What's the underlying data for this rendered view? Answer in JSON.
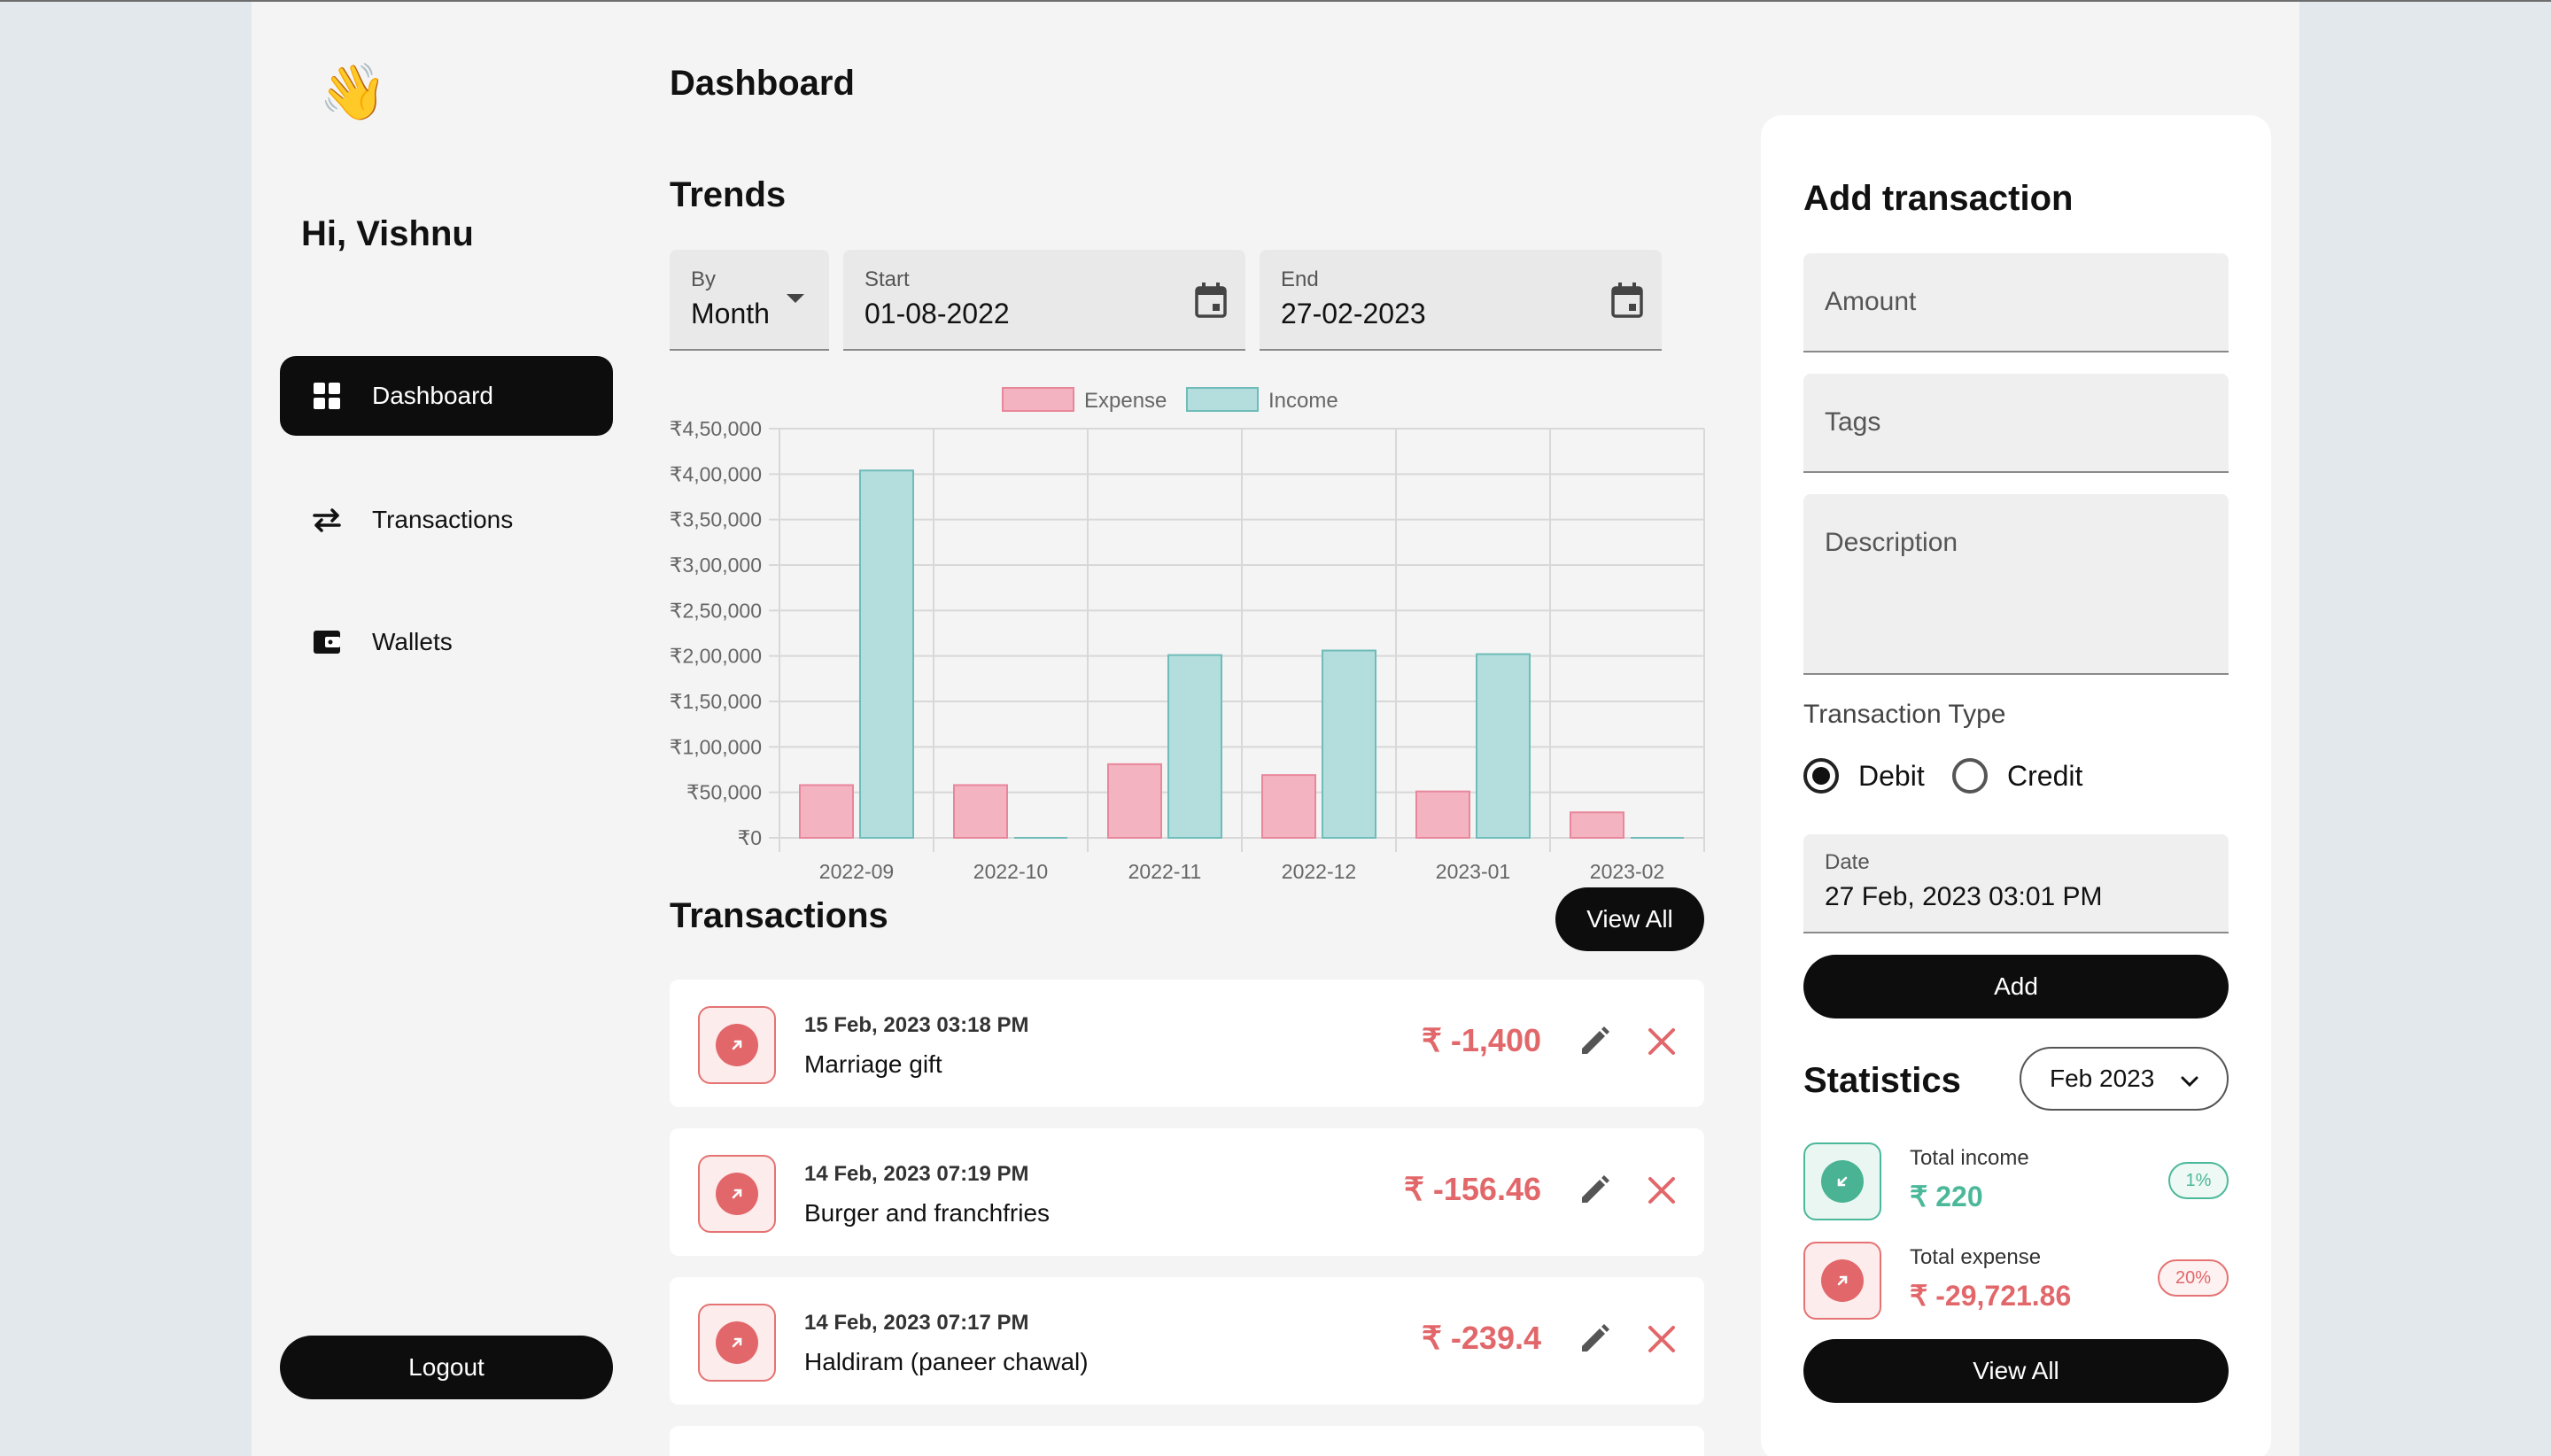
{
  "sidebar": {
    "emoji": "👋",
    "greeting": "Hi, Vishnu",
    "items": [
      {
        "label": "Dashboard",
        "icon": "grid-icon",
        "active": true
      },
      {
        "label": "Transactions",
        "icon": "swap-arrows-icon",
        "active": false
      },
      {
        "label": "Wallets",
        "icon": "wallet-icon",
        "active": false
      }
    ],
    "logout_label": "Logout"
  },
  "main": {
    "title": "Dashboard",
    "trends_title": "Trends",
    "filters": {
      "by": {
        "label": "By",
        "value": "Month"
      },
      "start": {
        "label": "Start",
        "value": "01-08-2022"
      },
      "end": {
        "label": "End",
        "value": "27-02-2023"
      }
    },
    "transactions_title": "Transactions",
    "view_all_label": "View All",
    "transactions": [
      {
        "date": "15 Feb, 2023 03:18 PM",
        "description": "Marriage gift",
        "amount": "₹ -1,400"
      },
      {
        "date": "14 Feb, 2023 07:19 PM",
        "description": "Burger and franchfries",
        "amount": "₹ -156.46"
      },
      {
        "date": "14 Feb, 2023 07:17 PM",
        "description": "Haldiram (paneer chawal)",
        "amount": "₹ -239.4"
      }
    ]
  },
  "chart_data": {
    "type": "bar",
    "categories": [
      "2022-09",
      "2022-10",
      "2022-11",
      "2022-12",
      "2023-01",
      "2023-02"
    ],
    "series": [
      {
        "name": "Expense",
        "values": [
          58000,
          58000,
          81000,
          69000,
          51000,
          28000
        ],
        "color": "#f4b3c0",
        "stroke": "#e8879b"
      },
      {
        "name": "Income",
        "values": [
          404000,
          0,
          201000,
          206000,
          202000,
          0
        ],
        "color": "#b3dedd",
        "stroke": "#6fbcb9"
      }
    ],
    "ylim": [
      0,
      450000
    ],
    "yticks": [
      "₹0",
      "₹50,000",
      "₹1,00,000",
      "₹1,50,000",
      "₹2,00,000",
      "₹2,50,000",
      "₹3,00,000",
      "₹3,50,000",
      "₹4,00,000",
      "₹4,50,000"
    ],
    "legend": "top-center",
    "grid": true
  },
  "add_transaction": {
    "title": "Add transaction",
    "amount_placeholder": "Amount",
    "tags_placeholder": "Tags",
    "description_placeholder": "Description",
    "type_label": "Transaction Type",
    "debit_label": "Debit",
    "credit_label": "Credit",
    "selected_type": "Debit",
    "date_label": "Date",
    "date_value": "27 Feb, 2023 03:01 PM",
    "add_label": "Add"
  },
  "statistics": {
    "title": "Statistics",
    "month": "Feb 2023",
    "income_label": "Total income",
    "income_value": "₹ 220",
    "income_pct": "1%",
    "expense_label": "Total expense",
    "expense_value": "₹ -29,721.86",
    "expense_pct": "20%",
    "view_all_label": "View All"
  },
  "colors": {
    "accent": "#0d0d0d",
    "expense": "#e2676a",
    "income": "#4cb89a"
  }
}
